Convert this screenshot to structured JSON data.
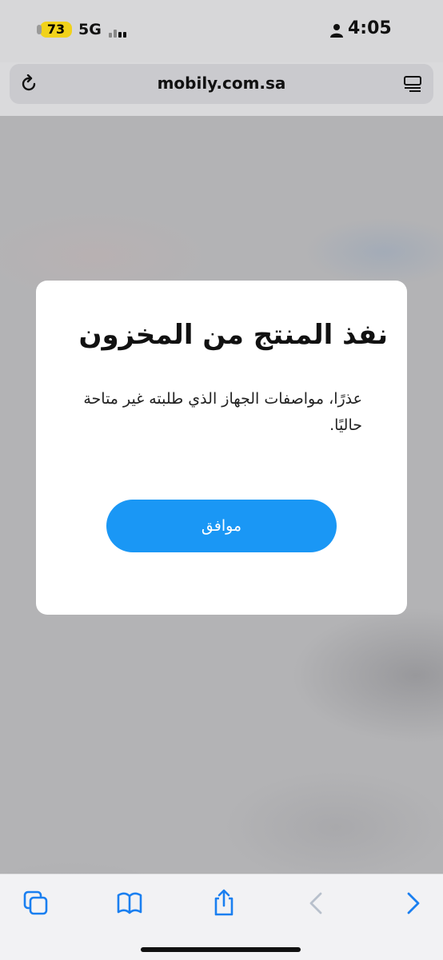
{
  "status": {
    "battery": "73",
    "network": "5G",
    "time": "4:05"
  },
  "browser": {
    "url": "mobily.com.sa"
  },
  "dialog": {
    "title": "نفذ المنتج من المخزون",
    "message": "عذرًا، مواصفات الجهاز الذي طلبته غير متاحة حاليًا.",
    "ok_label": "موافق"
  },
  "toolbar": {
    "icons": [
      "tabs-icon",
      "bookmarks-icon",
      "share-icon",
      "back-icon",
      "forward-icon"
    ]
  },
  "colors": {
    "accent": "#1a97f5",
    "battery": "#f1d21a",
    "toolbar_icon": "#1a7ff0"
  }
}
